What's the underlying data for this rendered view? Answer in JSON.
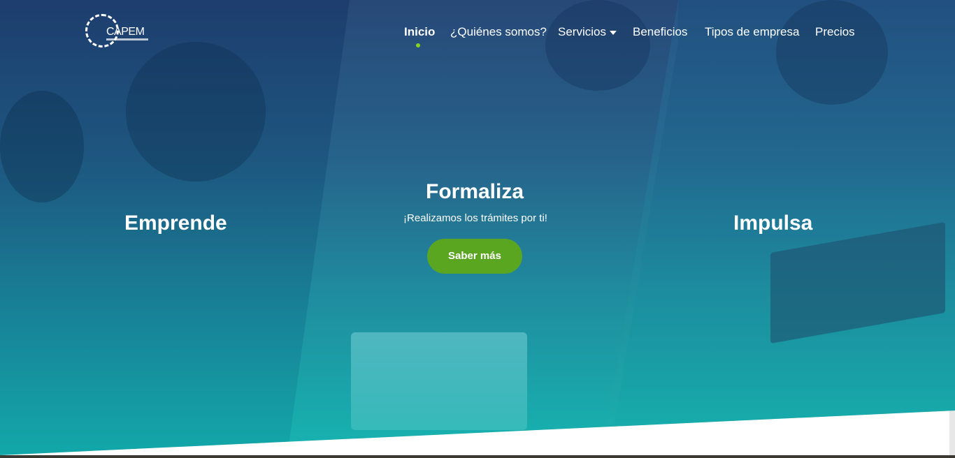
{
  "brand": {
    "logo_text": "CAPEM"
  },
  "nav": {
    "items": [
      {
        "label": "Inicio"
      },
      {
        "label": "¿Quiénes somos?"
      },
      {
        "label": "Servicios"
      },
      {
        "label": "Beneficios"
      },
      {
        "label": "Tipos de empresa"
      },
      {
        "label": "Precios"
      }
    ]
  },
  "hero": {
    "left_title": "Emprende",
    "center_title": "Formaliza",
    "center_subtitle": "¡Realizamos los trámites por ti!",
    "cta_label": "Saber más",
    "right_title": "Impulsa"
  },
  "colors": {
    "accent": "#5aa621",
    "nav_dot": "#8bd21f",
    "hero_top": "#1c3f6d",
    "hero_bottom": "#11b3b0"
  }
}
